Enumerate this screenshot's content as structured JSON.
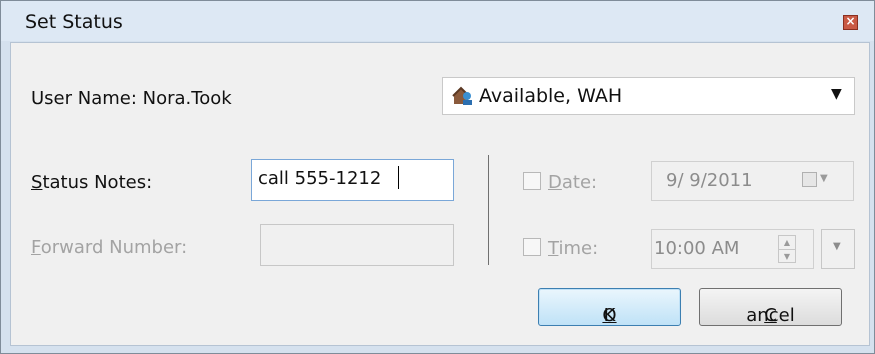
{
  "window": {
    "title": "Set Status"
  },
  "user": {
    "label": "User Name: Nora.Took"
  },
  "status_dropdown": {
    "selected": "Available, WAH",
    "icon": "status-available-wah-icon"
  },
  "status_notes": {
    "label_underlined": "S",
    "label_rest": "tatus Notes:",
    "value": "call 555-1212"
  },
  "forward_number": {
    "label_underlined": "F",
    "label_rest": "orward Number:",
    "value": ""
  },
  "date": {
    "label_underlined": "D",
    "label_rest": "ate:",
    "value": "9/  9/2011",
    "checked": false
  },
  "time": {
    "label_underlined": "T",
    "label_rest": "ime:",
    "value": "10:00 AM",
    "checked": false
  },
  "buttons": {
    "ok_underlined": "O",
    "ok_rest": "K",
    "cancel_underlined": "C",
    "cancel_rest": "ancel"
  }
}
